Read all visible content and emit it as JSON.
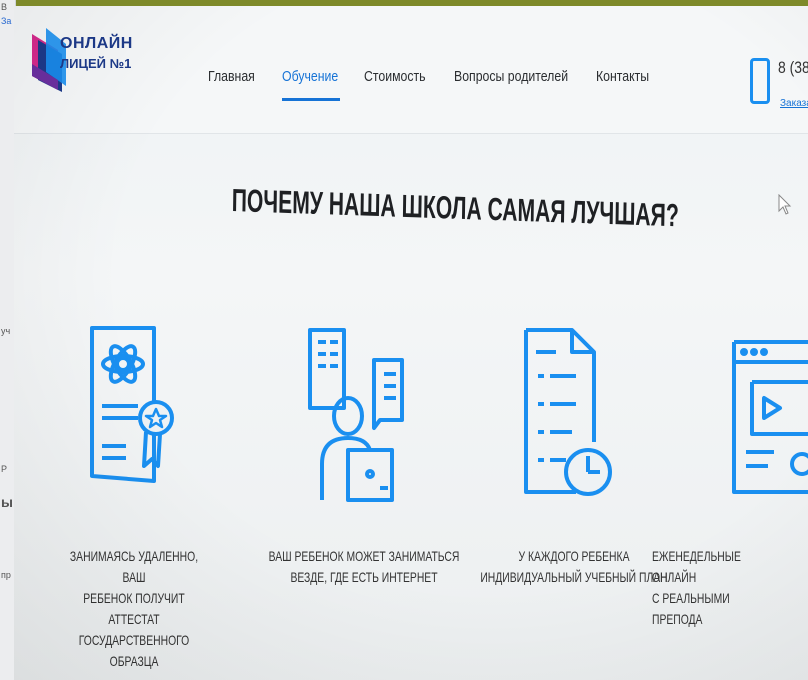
{
  "left_strip": {
    "fragments": [
      "В",
      "За",
      "уч",
      "Р",
      "ы",
      "пр"
    ]
  },
  "header": {
    "logo": {
      "line1": "ОНЛАЙН",
      "line2": "ЛИЦЕЙ №1"
    },
    "nav": {
      "items": [
        {
          "label": "Главная",
          "active": false
        },
        {
          "label": "Обучение",
          "active": true
        },
        {
          "label": "Стоимость",
          "active": false
        },
        {
          "label": "Вопросы родителей",
          "active": false
        },
        {
          "label": "Контакты",
          "active": false
        }
      ]
    },
    "phone": {
      "number": "8 (38",
      "callback_link": "Заказат"
    }
  },
  "main": {
    "headline": "ПОЧЕМУ НАША ШКОЛА САМАЯ ЛУЧШАЯ?",
    "features": [
      {
        "icon": "diploma-icon",
        "caption": "ЗАНИМАЯСЬ УДАЛЕННО, ВАШ\nРЕБЕНОК ПОЛУЧИТ АТТЕСТАТ\nГОСУДАРСТВЕННОГО ОБРАЗЦА"
      },
      {
        "icon": "student-laptop-icon",
        "caption": "ВАШ РЕБЕНОК МОЖЕТ ЗАНИМАТЬСЯ\nВЕЗДЕ, ГДЕ ЕСТЬ ИНТЕРНЕТ"
      },
      {
        "icon": "plan-document-icon",
        "caption": "У КАЖДОГО РЕБЕНКА\nИНДИВИДУАЛЬНЫЙ УЧЕБНЫЙ ПЛАН"
      },
      {
        "icon": "video-lesson-icon",
        "caption": "ЕЖЕНЕДЕЛЬНЫЕ ОНЛАЙН\nС РЕАЛЬНЫМИ ПРЕПОДА"
      }
    ]
  },
  "colors": {
    "accent": "#1673d6",
    "icon_blue": "#1a8ff0",
    "text": "#333333",
    "frame": "#7e8a2a"
  }
}
